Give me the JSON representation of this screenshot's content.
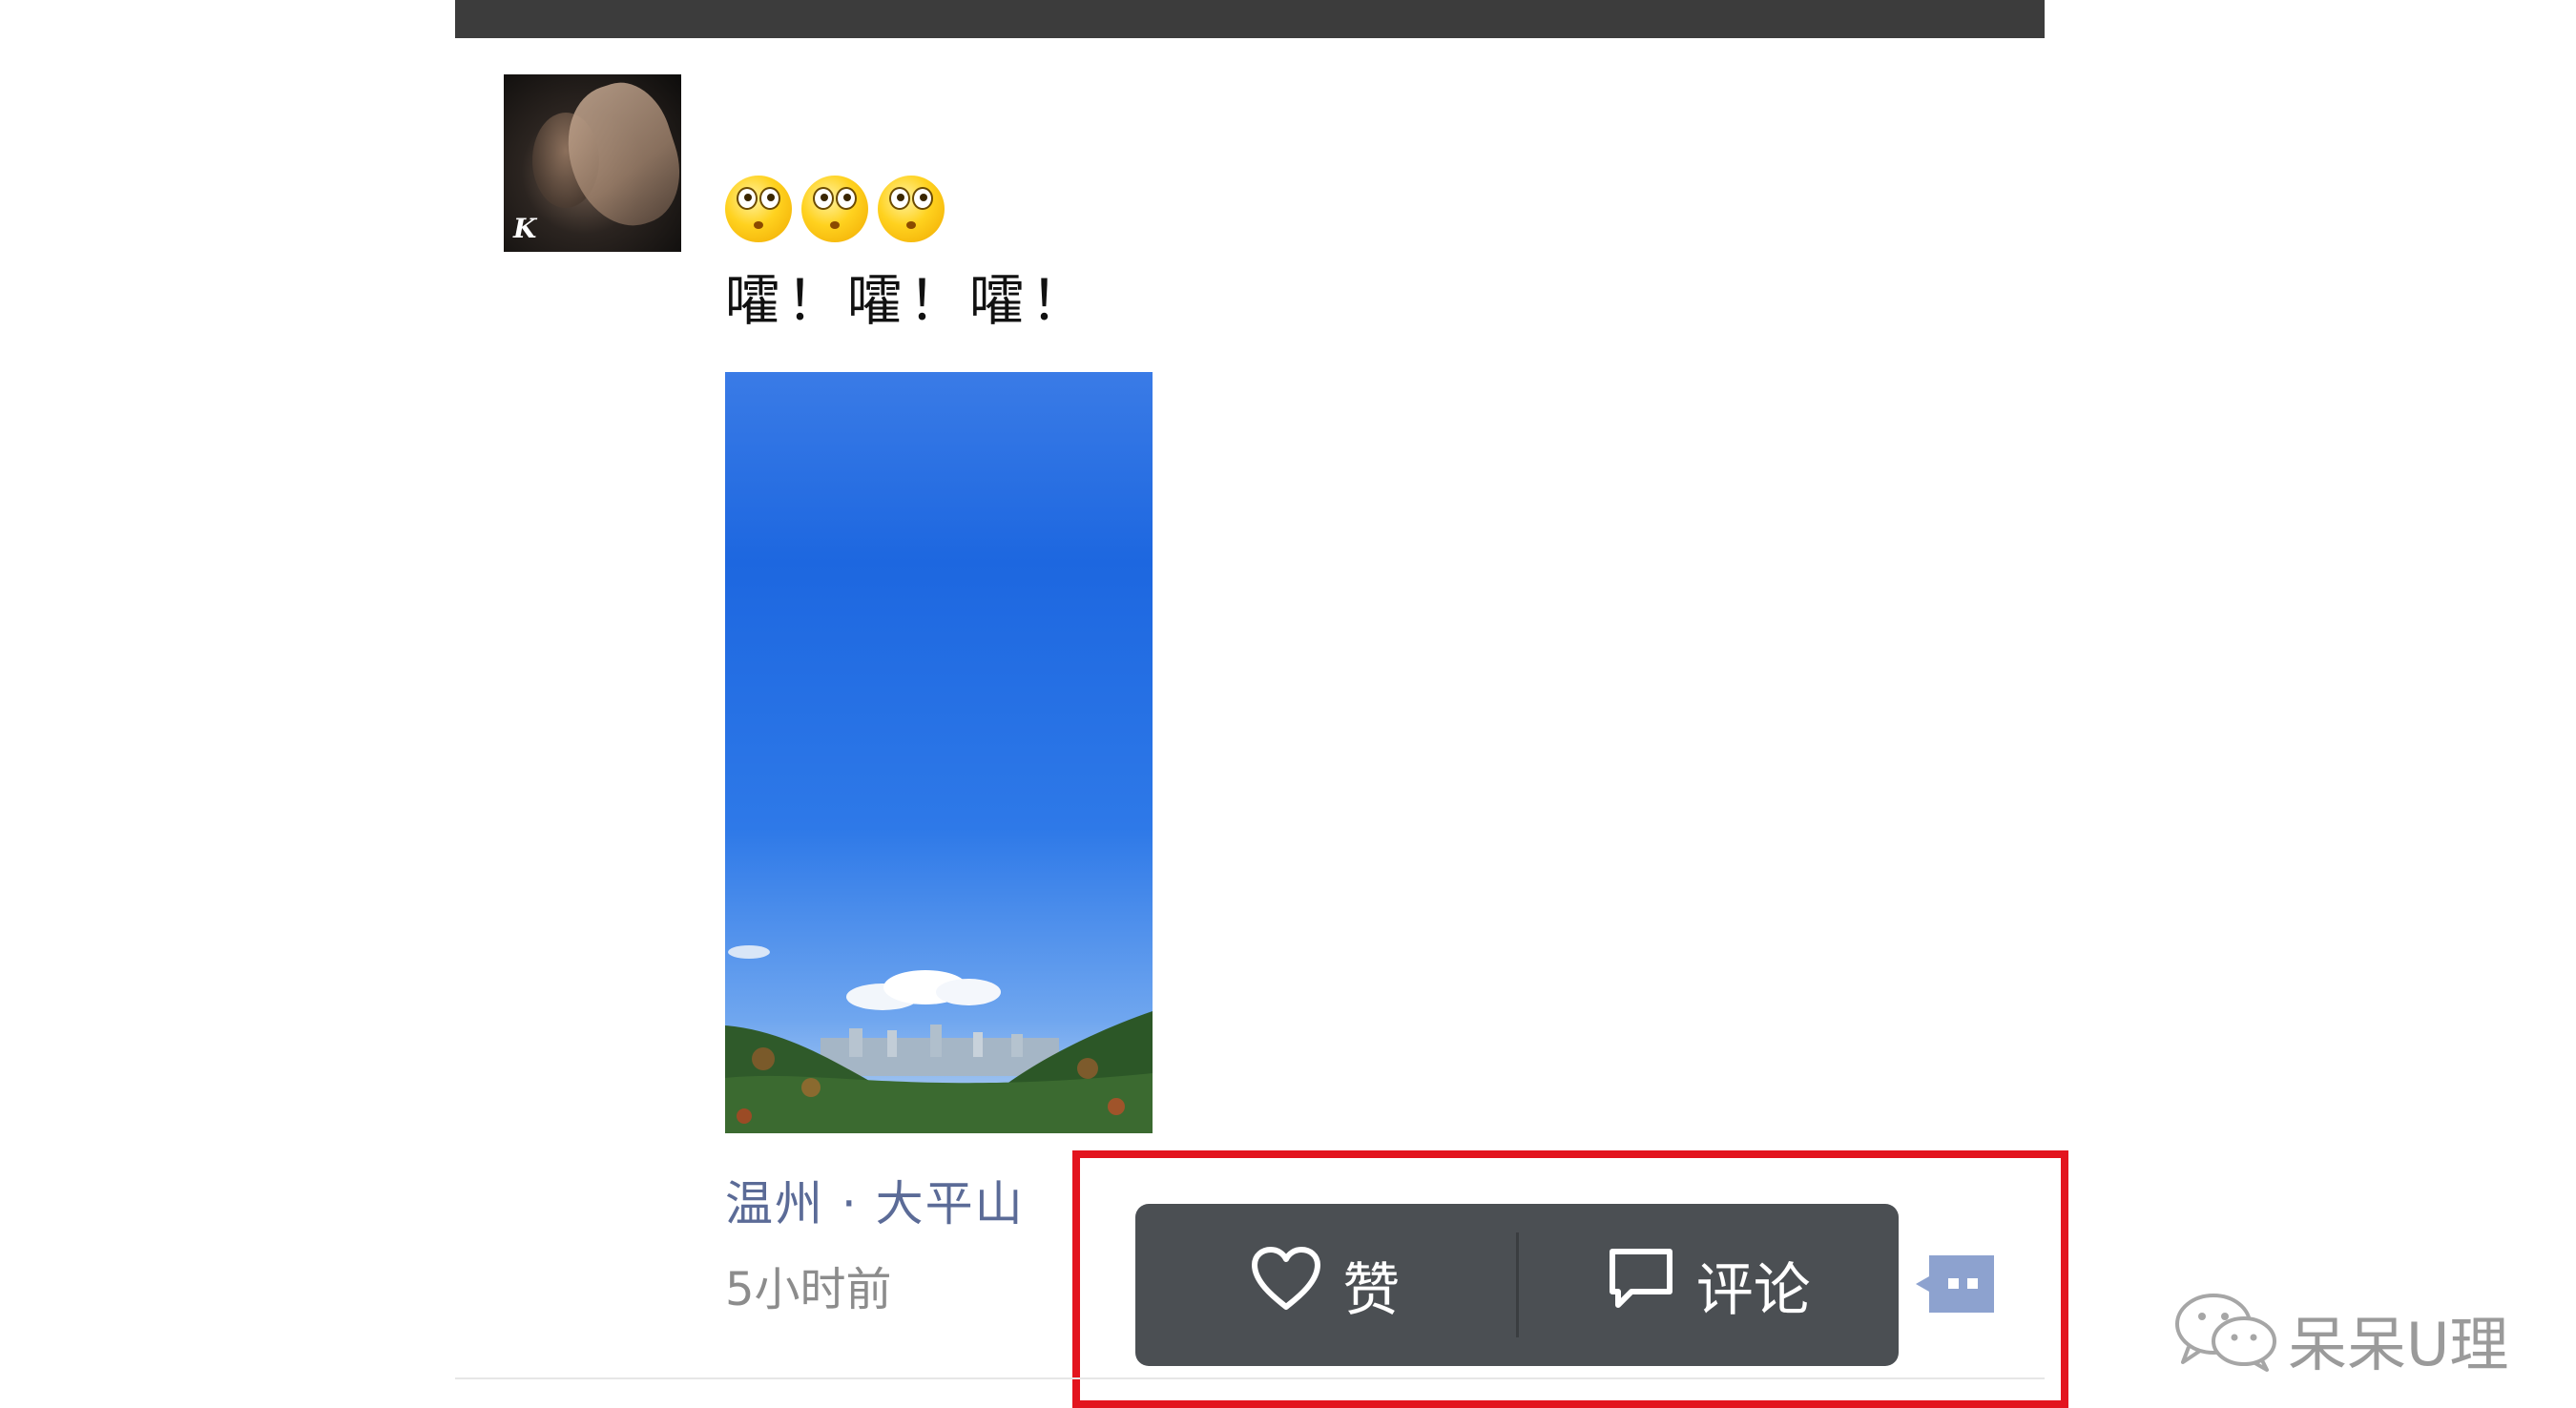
{
  "post": {
    "emojis": [
      "dizzy-eyes-face",
      "dizzy-eyes-face",
      "dizzy-eyes-face"
    ],
    "text": "嚯！嚯！嚯！",
    "photo_description_icon": "landscape-photo",
    "location": "温州 · 大平山",
    "time_ago": "5小时前"
  },
  "action_menu": {
    "like_label": "赞",
    "like_icon": "heart-icon",
    "comment_label": "评论",
    "comment_icon": "comment-bubble-icon",
    "more_icon": "more-dots-icon"
  },
  "watermark": {
    "text": "呆呆U理",
    "icon": "wechat-logo"
  },
  "colors": {
    "highlight": "#e3141e",
    "menu_bg": "#4b4f53",
    "location_link": "#5b6b97",
    "more_button": "#8da2cf"
  }
}
